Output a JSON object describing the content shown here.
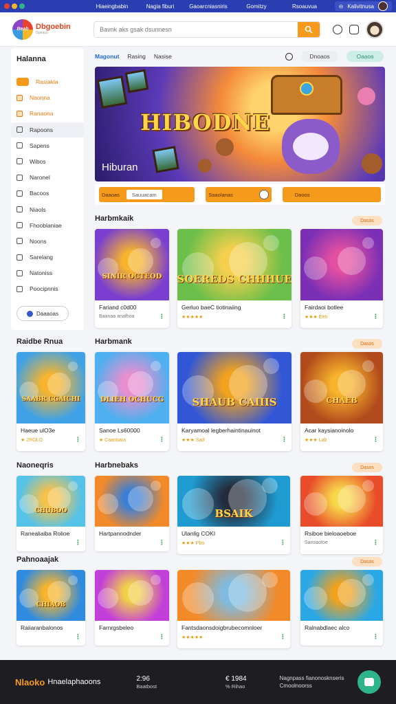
{
  "topbar": {
    "nav": [
      "Hiaeingbabin",
      "Nagia fiburi",
      "Gaoarcniasniris",
      "Gomitzy",
      "Rsoauvua"
    ],
    "account": "Kalivitnusa",
    "dot_colors": [
      "#e8412f",
      "#f6b625",
      "#2fb38a"
    ]
  },
  "header": {
    "logo_badge": "Beab",
    "logo_text": "Dbgoebin",
    "logo_sub": "Gpeaso",
    "search_placeholder": "Bavnk aks gsak dsunnesn",
    "accent": "#f59a1a"
  },
  "sidebar": {
    "title": "Halanna",
    "items": [
      {
        "label": "Rasiakla"
      },
      {
        "label": "Naonna"
      },
      {
        "label": "Ranaona"
      },
      {
        "label": "Rapoons"
      },
      {
        "label": "Sapens"
      },
      {
        "label": "Wibos"
      },
      {
        "label": "Naronel"
      },
      {
        "label": "Bacoos"
      },
      {
        "label": "Niaols"
      },
      {
        "label": "Fhooblaniae"
      },
      {
        "label": "Noons"
      },
      {
        "label": "Sarelang"
      },
      {
        "label": "Natoniss"
      },
      {
        "label": "Poocipnnis"
      }
    ],
    "button": "Daaaoas"
  },
  "tabs": {
    "items": [
      "Magonut",
      "Rasing",
      "Nasise"
    ],
    "pill_grey": "Dnoaos",
    "pill_mint": "Oaaos"
  },
  "hero": {
    "title": "HIBODNE",
    "caption": "Hiburan",
    "actions": [
      {
        "label": "Daaoas",
        "box": "Sauuacam"
      },
      {
        "label": "Saaolanas"
      },
      {
        "label": "Daoos"
      }
    ]
  },
  "sections": [
    {
      "side_title": "",
      "title": "Harbmkaik",
      "pill": "Dasos",
      "cards": [
        {
          "title": "Fariand c0d00",
          "meta": "Baanaa anafhoa",
          "thumb_label": "SINIR OCTEOD",
          "colors": [
            "#7a3fd0",
            "#f7b42c"
          ]
        },
        {
          "title": "Gerluo baeC tiotinaiing",
          "meta": "★★★★★",
          "thumb_label": "SOEREDS CHHHUE",
          "colors": [
            "#6bbf4a",
            "#f6d04d"
          ]
        },
        {
          "title": "Fairdaoi botlee",
          "meta": "★★★ Eeh",
          "thumb_label": "",
          "colors": [
            "#7b2fb5",
            "#e34fa1"
          ]
        }
      ]
    },
    {
      "side_title": "Raidbe Rnua",
      "title": "Harbmank",
      "pill": "Dasos",
      "cards": [
        {
          "title": "Haeue ulO3e",
          "meta": "★ 2ROLO",
          "thumb_label": "SAABR CGAICHI",
          "colors": [
            "#3fa2e6",
            "#f7b42c"
          ]
        },
        {
          "title": "Sanoe Ls60000",
          "meta": "★ Caanbara",
          "thumb_label": "DLIEH OCHUCG",
          "colors": [
            "#4db0f0",
            "#e98fd0"
          ]
        },
        {
          "title": "Karyamoal legberhaintinauinot",
          "meta": "★★★ Sad",
          "thumb_label": "SHAUB CAIIIS",
          "colors": [
            "#3257d6",
            "#f2a21c"
          ]
        },
        {
          "title": "Acar kaysianoinolo",
          "meta": "★★★ Lab",
          "thumb_label": "CHAEB",
          "colors": [
            "#b14a1c",
            "#f7b42c"
          ]
        }
      ]
    },
    {
      "side_title": "Naoneqris",
      "title": "Harbnebaks",
      "pill": "Dasos",
      "cards": [
        {
          "title": "Ranealiaiba Rolioe",
          "meta": "",
          "thumb_label": "CHUBOO",
          "colors": [
            "#55c2e8",
            "#f7c24a"
          ]
        },
        {
          "title": "Hartpannodnder",
          "meta": "",
          "thumb_label": "",
          "colors": [
            "#f28a2a",
            "#3a7fd6"
          ]
        },
        {
          "title": "Ulanlig COKI",
          "meta": "★★★ Pbo",
          "thumb_label": "BSAIK",
          "colors": [
            "#1f9bd1",
            "#242b3a"
          ]
        },
        {
          "title": "Rsiboe bieloaoeboe",
          "meta": "Sanoaotoe",
          "thumb_label": "",
          "colors": [
            "#e84c2a",
            "#f7d84a"
          ]
        }
      ]
    },
    {
      "side_title": "Pahnoaajak",
      "title": "",
      "pill": "Dasos",
      "cards": [
        {
          "title": "Raiiaranbalonos",
          "meta": "",
          "thumb_label": "CHIAOB",
          "colors": [
            "#2f8be0",
            "#f7b42c"
          ]
        },
        {
          "title": "Farnrgsbeleo",
          "meta": "",
          "thumb_label": "",
          "colors": [
            "#c23fd9",
            "#f2d04a"
          ]
        },
        {
          "title": "Fantsdaonsdoigbrubecomnloer",
          "meta": "★★★★★",
          "thumb_label": "",
          "colors": [
            "#f28a2a",
            "#7fbbe0"
          ]
        },
        {
          "title": "Ralnabdlaec alco",
          "meta": "",
          "thumb_label": "",
          "colors": [
            "#2aa8e6",
            "#f2a21c"
          ]
        }
      ]
    }
  ],
  "footer": {
    "brand": "Nlaoko",
    "brand_text": "Hnaelaphaoons",
    "stat1_value": "2:96",
    "stat1_label": "Baatbost",
    "stat2_value": "€ 1984",
    "stat2_label": "% Rihao",
    "right_line1": "Nagnpass fianonosknseris",
    "right_line2": "Cmoolnoorss"
  }
}
